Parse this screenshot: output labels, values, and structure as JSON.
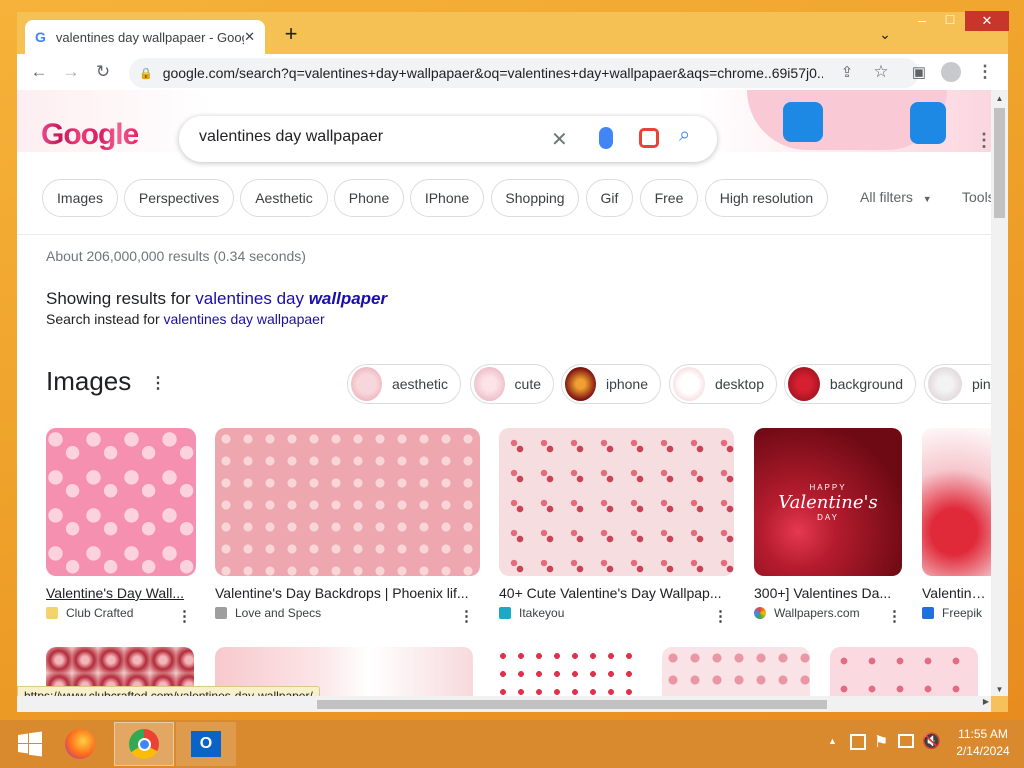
{
  "browser": {
    "tab_title": "valentines day wallpapaer - Goog",
    "new_tab": "+",
    "url": "google.com/search?q=valentines+day+wallpapaer&oq=valentines+day+wallpapaer&aqs=chrome..69i57j0...",
    "status_url": "https://www.clubcrafted.com/valentines-day-wallpaper/",
    "window_controls": {
      "minimize": "–",
      "maximize": "□",
      "close": "✕"
    }
  },
  "search": {
    "query": "valentines day wallpapaer",
    "logo": "Google"
  },
  "filters": [
    "Images",
    "Perspectives",
    "Aesthetic",
    "Phone",
    "IPhone",
    "Shopping",
    "Gif",
    "Free",
    "High resolution"
  ],
  "filter_tools": {
    "all_filters": "All filters",
    "tools": "Tools"
  },
  "results": {
    "stats": "About 206,000,000 results (0.34 seconds)",
    "showing_prefix": "Showing results for ",
    "corrected_plain": "valentines day ",
    "corrected_emph": "wallpaper",
    "instead_prefix": "Search instead for ",
    "instead_link": "valentines day wallpapaer"
  },
  "images_section": {
    "title": "Images",
    "related": [
      "aesthetic",
      "cute",
      "iphone",
      "desktop",
      "background",
      "pin"
    ]
  },
  "image_cards": [
    {
      "caption": "Valentine's Day Wall...",
      "source": "Club Crafted"
    },
    {
      "caption": "Valentine's Day Backdrops | Phoenix lif...",
      "source": "Love and Specs"
    },
    {
      "caption": "40+ Cute Valentine's Day Wallpap...",
      "source": "Itakeyou"
    },
    {
      "caption": "300+] Valentines Da...",
      "source": "Wallpapers.com"
    },
    {
      "caption": "Valentine W",
      "source": "Freepik"
    }
  ],
  "valentine_overlay": {
    "line1": "HAPPY",
    "line2": "Valentine's",
    "line3": "DAY"
  },
  "taskbar": {
    "time": "11:55 AM",
    "date": "2/14/2024"
  },
  "colors": {
    "accent_blue": "#1a0dab",
    "link_blue": "#1a0dab",
    "chip_border": "#dadce0"
  }
}
